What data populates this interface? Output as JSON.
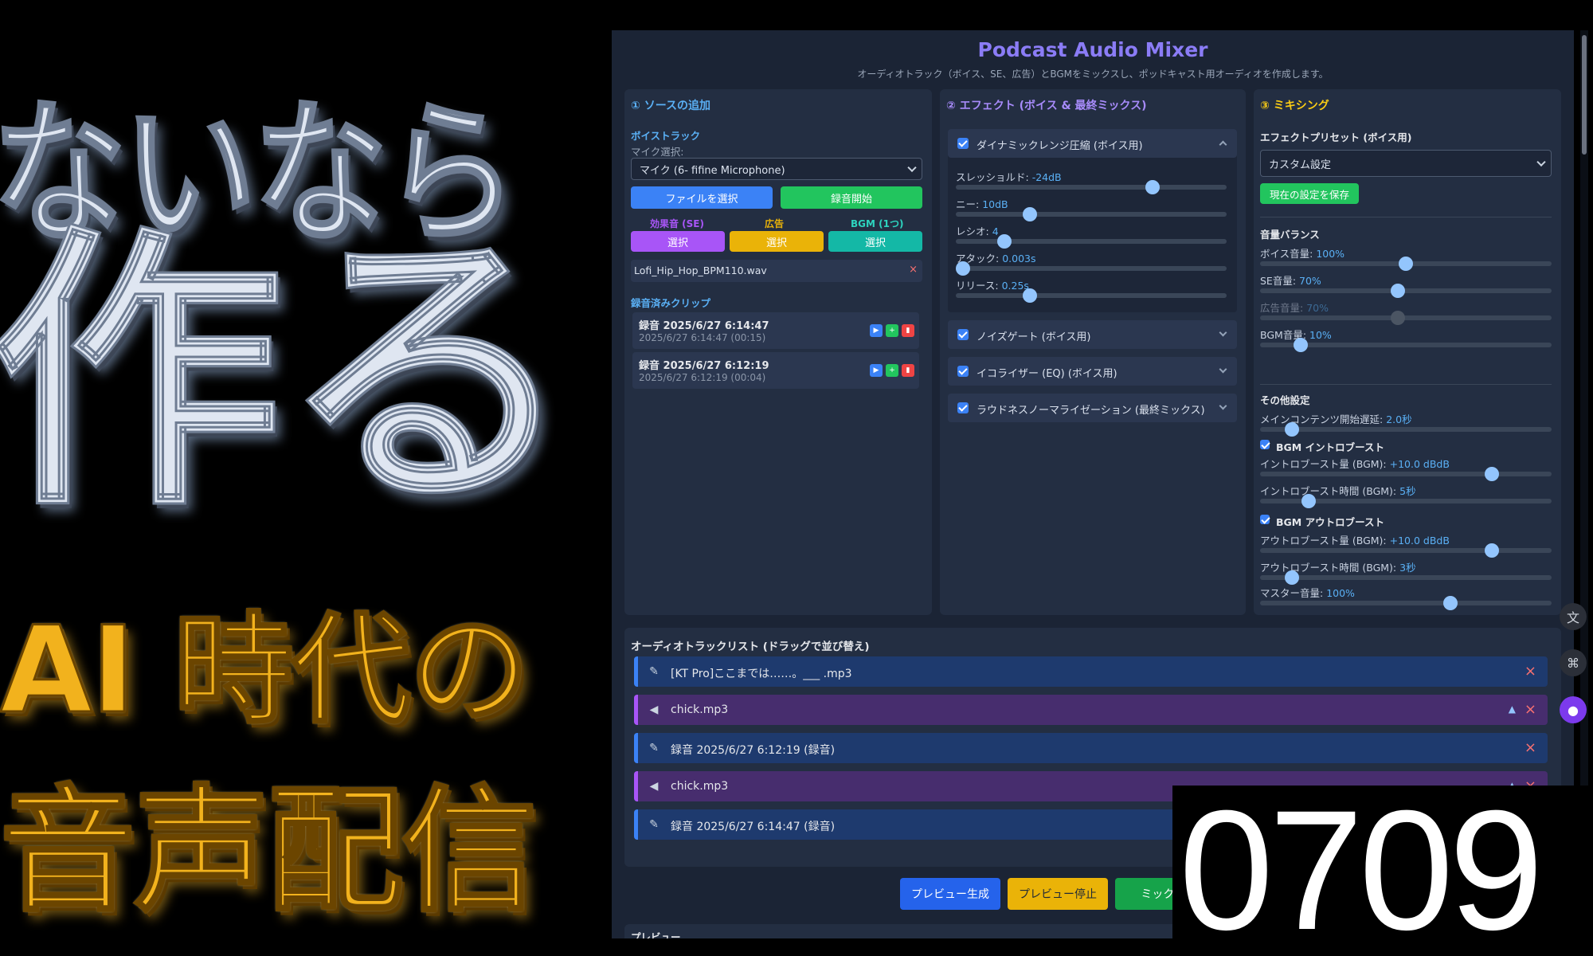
{
  "thumbnail": {
    "line1": "ないなら",
    "line2": "作る",
    "line3": "AI 時代の",
    "line4": "音声配信",
    "episode": "0709"
  },
  "app": {
    "title": "Podcast Audio Mixer",
    "subtitle": "オーディオトラック（ボイス、SE、広告）とBGMをミックスし、ポッドキャスト用オーディオを作成します。",
    "source": {
      "title": "① ソースの追加",
      "voice_label": "ボイストラック",
      "mic_label": "マイク選択:",
      "mic_value": "マイク (6- fifine Microphone)",
      "file_button": "ファイルを選択",
      "record_button": "録音開始",
      "se_label": "効果音 (SE)",
      "ad_label": "広告",
      "bgm_label": "BGM (1つ)",
      "select_label": "選択",
      "bgm_file": "Lofi_Hip_Hop_BPM110.wav",
      "clips_title": "録音済みクリップ",
      "clips": [
        {
          "name": "録音 2025/6/27 6:14:47",
          "detail": "2025/6/27 6:14:47 (00:15)"
        },
        {
          "name": "録音 2025/6/27 6:12:19",
          "detail": "2025/6/27 6:12:19 (00:04)"
        }
      ]
    },
    "effects": {
      "title": "② エフェクト (ボイス & 最終ミックス)",
      "dynamics_title": "ダイナミックレンジ圧縮 (ボイス用)",
      "params": [
        {
          "label": "スレッショルド:",
          "value": "-24dB",
          "level": 0.74
        },
        {
          "label": "ニー:",
          "value": "10dB",
          "level": 0.26
        },
        {
          "label": "レシオ:",
          "value": "4",
          "level": 0.16
        },
        {
          "label": "アタック:",
          "value": "0.003s",
          "level": 0.0
        },
        {
          "label": "リリース:",
          "value": "0.25s",
          "level": 0.26
        }
      ],
      "noise_gate": "ノイズゲート (ボイス用)",
      "eq": "イコライザー (EQ) (ボイス用)",
      "loudness": "ラウドネスノーマライゼーション (最終ミックス)"
    },
    "mixing": {
      "title": "③ ミキシング",
      "preset_label": "エフェクトプリセット (ボイス用)",
      "preset_value": "カスタム設定",
      "save_button": "現在の設定を保存",
      "balance_title": "音量バランス",
      "volumes": [
        {
          "label": "ボイス音量:",
          "value": "100%",
          "level": 0.5
        },
        {
          "label": "SE音量:",
          "value": "70%",
          "level": 0.47
        },
        {
          "label": "広告音量:",
          "value": "70%",
          "level": 0.47,
          "disabled": true
        },
        {
          "label": "BGM音量:",
          "value": "10%",
          "level": 0.12
        }
      ],
      "other_title": "その他設定",
      "main_delay_label": "メインコンテンツ開始遅延:",
      "main_delay_value": "2.0秒",
      "main_delay_level": 0.09,
      "intro_boost_label": "BGM イントロブースト",
      "intro_amount_label": "イントロブースト量 (BGM):",
      "intro_amount_value": "+10.0 dBdB",
      "intro_amount_level": 0.81,
      "intro_time_label": "イントロブースト時間 (BGM):",
      "intro_time_value": "5秒",
      "intro_time_level": 0.15,
      "outro_boost_label": "BGM アウトロブースト",
      "outro_amount_label": "アウトロブースト量 (BGM):",
      "outro_amount_value": "+10.0 dBdB",
      "outro_amount_level": 0.81,
      "outro_time_label": "アウトロブースト時間 (BGM):",
      "outro_time_value": "3秒",
      "outro_time_level": 0.09,
      "master_label": "マスター音量:",
      "master_value": "100%",
      "master_level": 0.66
    },
    "tracklist": {
      "title": "オーディオトラックリスト (ドラッグで並び替え)",
      "tracks": [
        {
          "name": "[KT Pro]ここまでは……。___ .mp3",
          "kind": "voice"
        },
        {
          "name": "chick.mp3",
          "kind": "se"
        },
        {
          "name": "録音 2025/6/27 6:12:19 (録音)",
          "kind": "voice"
        },
        {
          "name": "chick.mp3",
          "kind": "se"
        },
        {
          "name": "録音 2025/6/27 6:14:47 (録音)",
          "kind": "voice"
        }
      ]
    },
    "actions": {
      "preview_generate": "プレビュー生成",
      "preview_stop": "プレビュー停止",
      "mix": "ミックス!"
    },
    "preview_title": "プレビュー"
  },
  "colors": {
    "accent": "#8b7cf6",
    "blue": "#3b82f6",
    "green": "#22c55e",
    "purple": "#a855f7",
    "yellow": "#eab308",
    "teal": "#14b8a6",
    "red": "#ef4444"
  }
}
